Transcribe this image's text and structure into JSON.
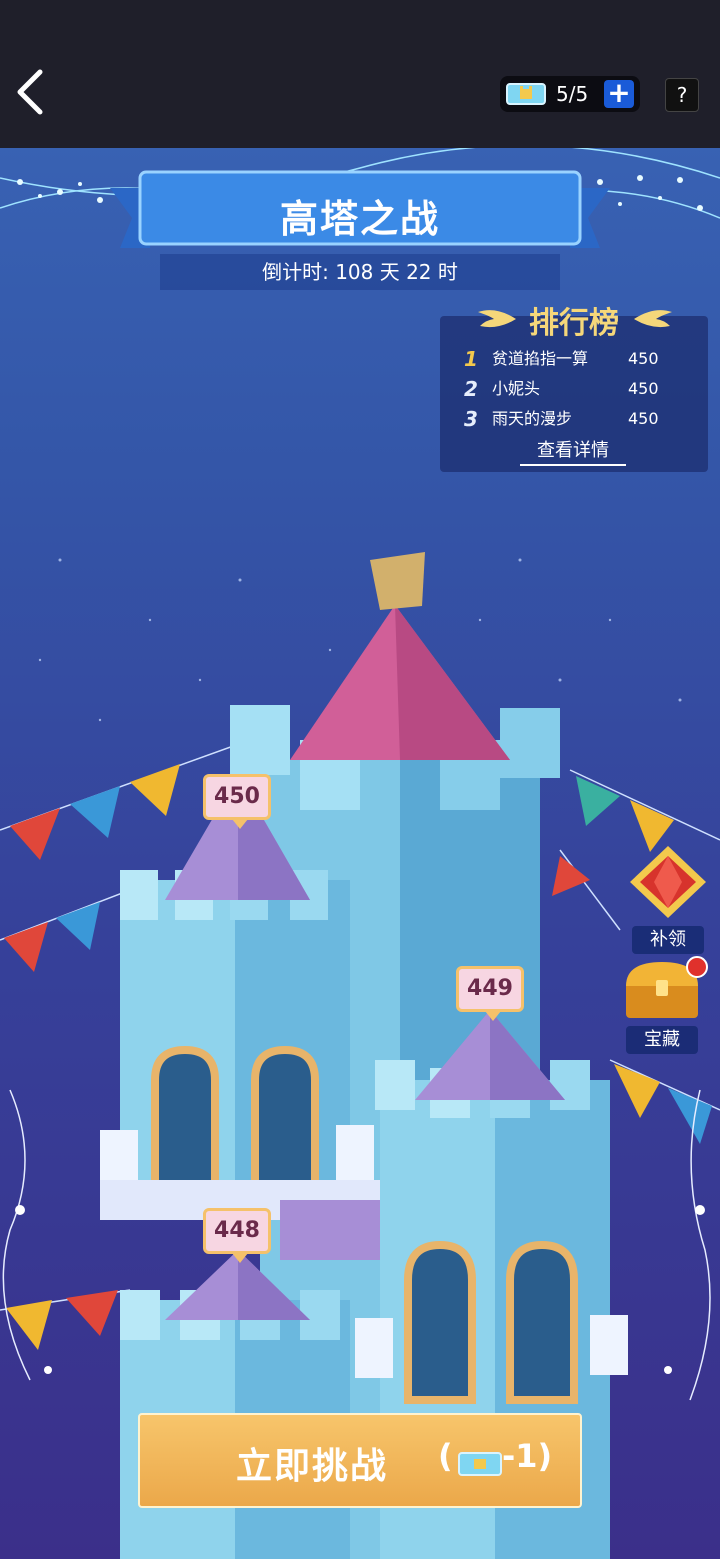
{
  "header": {
    "ticket_count": "5/5",
    "plus_label": "+",
    "help_label": "?"
  },
  "event": {
    "title": "高塔之战",
    "countdown": "倒计时: 108 天 22 时"
  },
  "leaderboard": {
    "title": "排行榜",
    "rows": [
      {
        "rank": "1",
        "name": "贫道掐指一算",
        "score": "450"
      },
      {
        "rank": "2",
        "name": "小妮头",
        "score": "450"
      },
      {
        "rank": "3",
        "name": "雨天的漫步",
        "score": "450"
      }
    ],
    "detail_link": "查看详情"
  },
  "side_buttons": {
    "reissue_label": "补领",
    "treasure_label": "宝藏"
  },
  "levels": {
    "top": "450",
    "right": "449",
    "bottom": "448"
  },
  "challenge": {
    "label": "立即挑战",
    "cost_open": "(",
    "cost_text": "-1)"
  },
  "colors": {
    "accent": "#eba84a",
    "plus_button": "#1a5bd8",
    "roof_pink": "#d15f98",
    "ice_blue": "#8fd3ec",
    "turret_purple": "#a78ed6"
  }
}
